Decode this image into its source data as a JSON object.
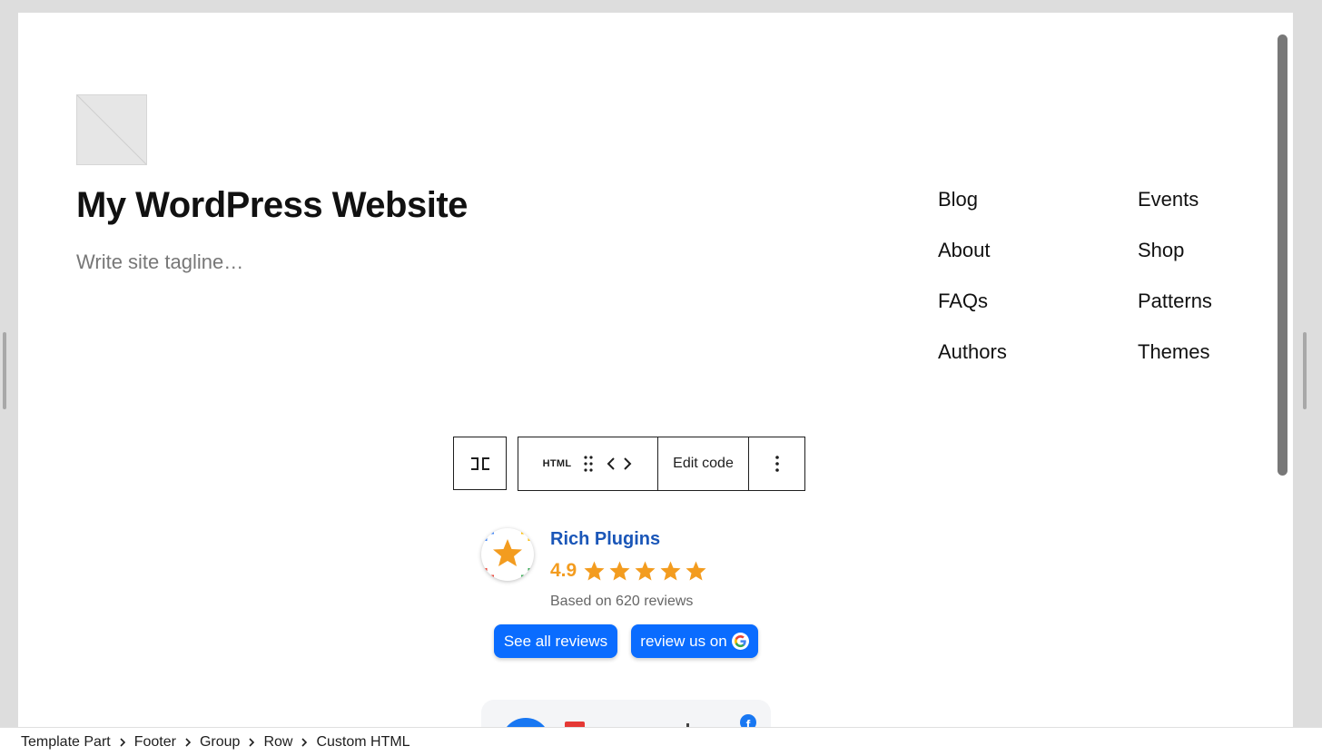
{
  "site": {
    "title": "My WordPress Website",
    "tagline": "Write site tagline…"
  },
  "nav": {
    "items": [
      "Blog",
      "About",
      "FAQs",
      "Authors",
      "Events",
      "Shop",
      "Patterns",
      "Themes"
    ]
  },
  "toolbar": {
    "html_label": "HTML",
    "edit_code_label": "Edit code"
  },
  "reviews_widget": {
    "business_name": "Rich Plugins",
    "rating": "4.9",
    "stars": 5,
    "based_on": "Based on 620 reviews",
    "see_all_label": "See all reviews",
    "review_us_label": "review us on",
    "brand_colors": {
      "name": "#1a56b8",
      "star": "#f39c1f",
      "button": "#0a6cff"
    }
  },
  "breadcrumb": {
    "items": [
      "Template Part",
      "Footer",
      "Group",
      "Row",
      "Custom HTML"
    ]
  }
}
